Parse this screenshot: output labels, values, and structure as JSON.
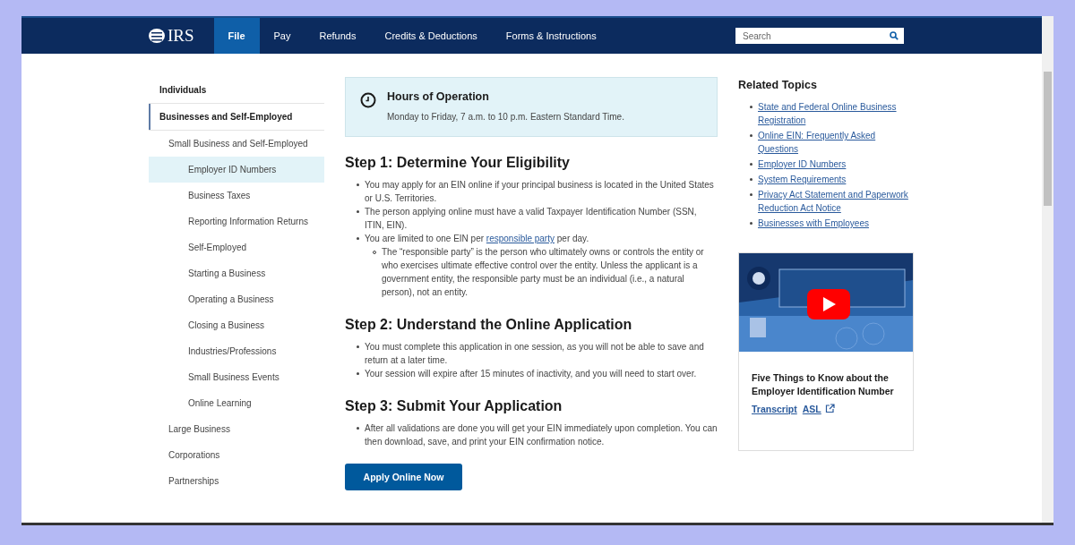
{
  "nav": {
    "logo": "IRS",
    "tabs": [
      {
        "label": "File",
        "selected": true
      },
      {
        "label": "Pay",
        "selected": false
      },
      {
        "label": "Refunds",
        "selected": false
      },
      {
        "label": "Credits & Deductions",
        "selected": false
      },
      {
        "label": "Forms & Instructions",
        "selected": false
      }
    ],
    "search": {
      "placeholder": "Search"
    }
  },
  "sidebar": {
    "items": [
      {
        "label": "Individuals",
        "selected": false,
        "expanded": false
      },
      {
        "label": "Businesses and Self-Employed",
        "selected": false,
        "expanded": true,
        "children": [
          {
            "label": "Small Business and Self-Employed",
            "selected": false,
            "expanded": true,
            "children": [
              {
                "label": "Employer ID Numbers",
                "selected": true
              },
              {
                "label": "Business Taxes",
                "selected": false
              },
              {
                "label": "Reporting Information Returns",
                "selected": false
              },
              {
                "label": "Self-Employed",
                "selected": false
              },
              {
                "label": "Starting a Business",
                "selected": false
              },
              {
                "label": "Operating a Business",
                "selected": false
              },
              {
                "label": "Closing a Business",
                "selected": false
              },
              {
                "label": "Industries/Professions",
                "selected": false
              },
              {
                "label": "Small Business Events",
                "selected": false
              },
              {
                "label": "Online Learning",
                "selected": false
              }
            ]
          },
          {
            "label": "Large Business",
            "selected": false,
            "expanded": false
          },
          {
            "label": "Corporations",
            "selected": false,
            "expanded": false
          },
          {
            "label": "Partnerships",
            "selected": false,
            "expanded": false
          }
        ]
      }
    ]
  },
  "notice": {
    "title": "Hours of Operation",
    "text": "Monday to Friday, 7 a.m. to 10 p.m. Eastern Standard Time."
  },
  "steps": [
    {
      "heading": "Step 1: Determine Your Eligibility",
      "bullets": [
        {
          "text": "You may apply for an EIN online if your principal business is located in the United States or U.S. Territories."
        },
        {
          "text": "The person applying online must have a valid Taxpayer Identification Number (SSN, ITIN, EIN)."
        },
        {
          "text": "You are limited to one EIN per ",
          "link": "responsible party",
          "text_after": " per day.",
          "children": [
            {
              "text": "The “responsible party” is the person who ultimately owns or controls the entity or who exercises ultimate effective control over the entity. Unless the applicant is a government entity, the responsible party must be an individual (i.e., a natural person), not an entity."
            }
          ]
        }
      ]
    },
    {
      "heading": "Step 2: Understand the Online Application",
      "bullets": [
        {
          "text": "You must complete this application in one session, as you will not be able to save and return at a later time."
        },
        {
          "text": "Your session will expire after 15 minutes of inactivity, and you will need to start over."
        }
      ]
    },
    {
      "heading": "Step 3: Submit Your Application",
      "bullets": [
        {
          "text": "After all validations are done you will get your EIN immediately upon completion. You can then download, save, and print your EIN confirmation notice."
        }
      ]
    }
  ],
  "apply_button": "Apply Online Now",
  "related": {
    "title": "Related Topics",
    "links": [
      "State and Federal Online Business Registration",
      "Online EIN: Frequently Asked Questions",
      "Employer ID Numbers",
      "System Requirements",
      "Privacy Act Statement and Paperwork Reduction Act Notice",
      "Businesses with Employees"
    ]
  },
  "video": {
    "title": "Five Things to Know about the Employer Identification Number",
    "links": [
      {
        "label": "Transcript",
        "external": false
      },
      {
        "label": "ASL",
        "external": true
      }
    ]
  }
}
